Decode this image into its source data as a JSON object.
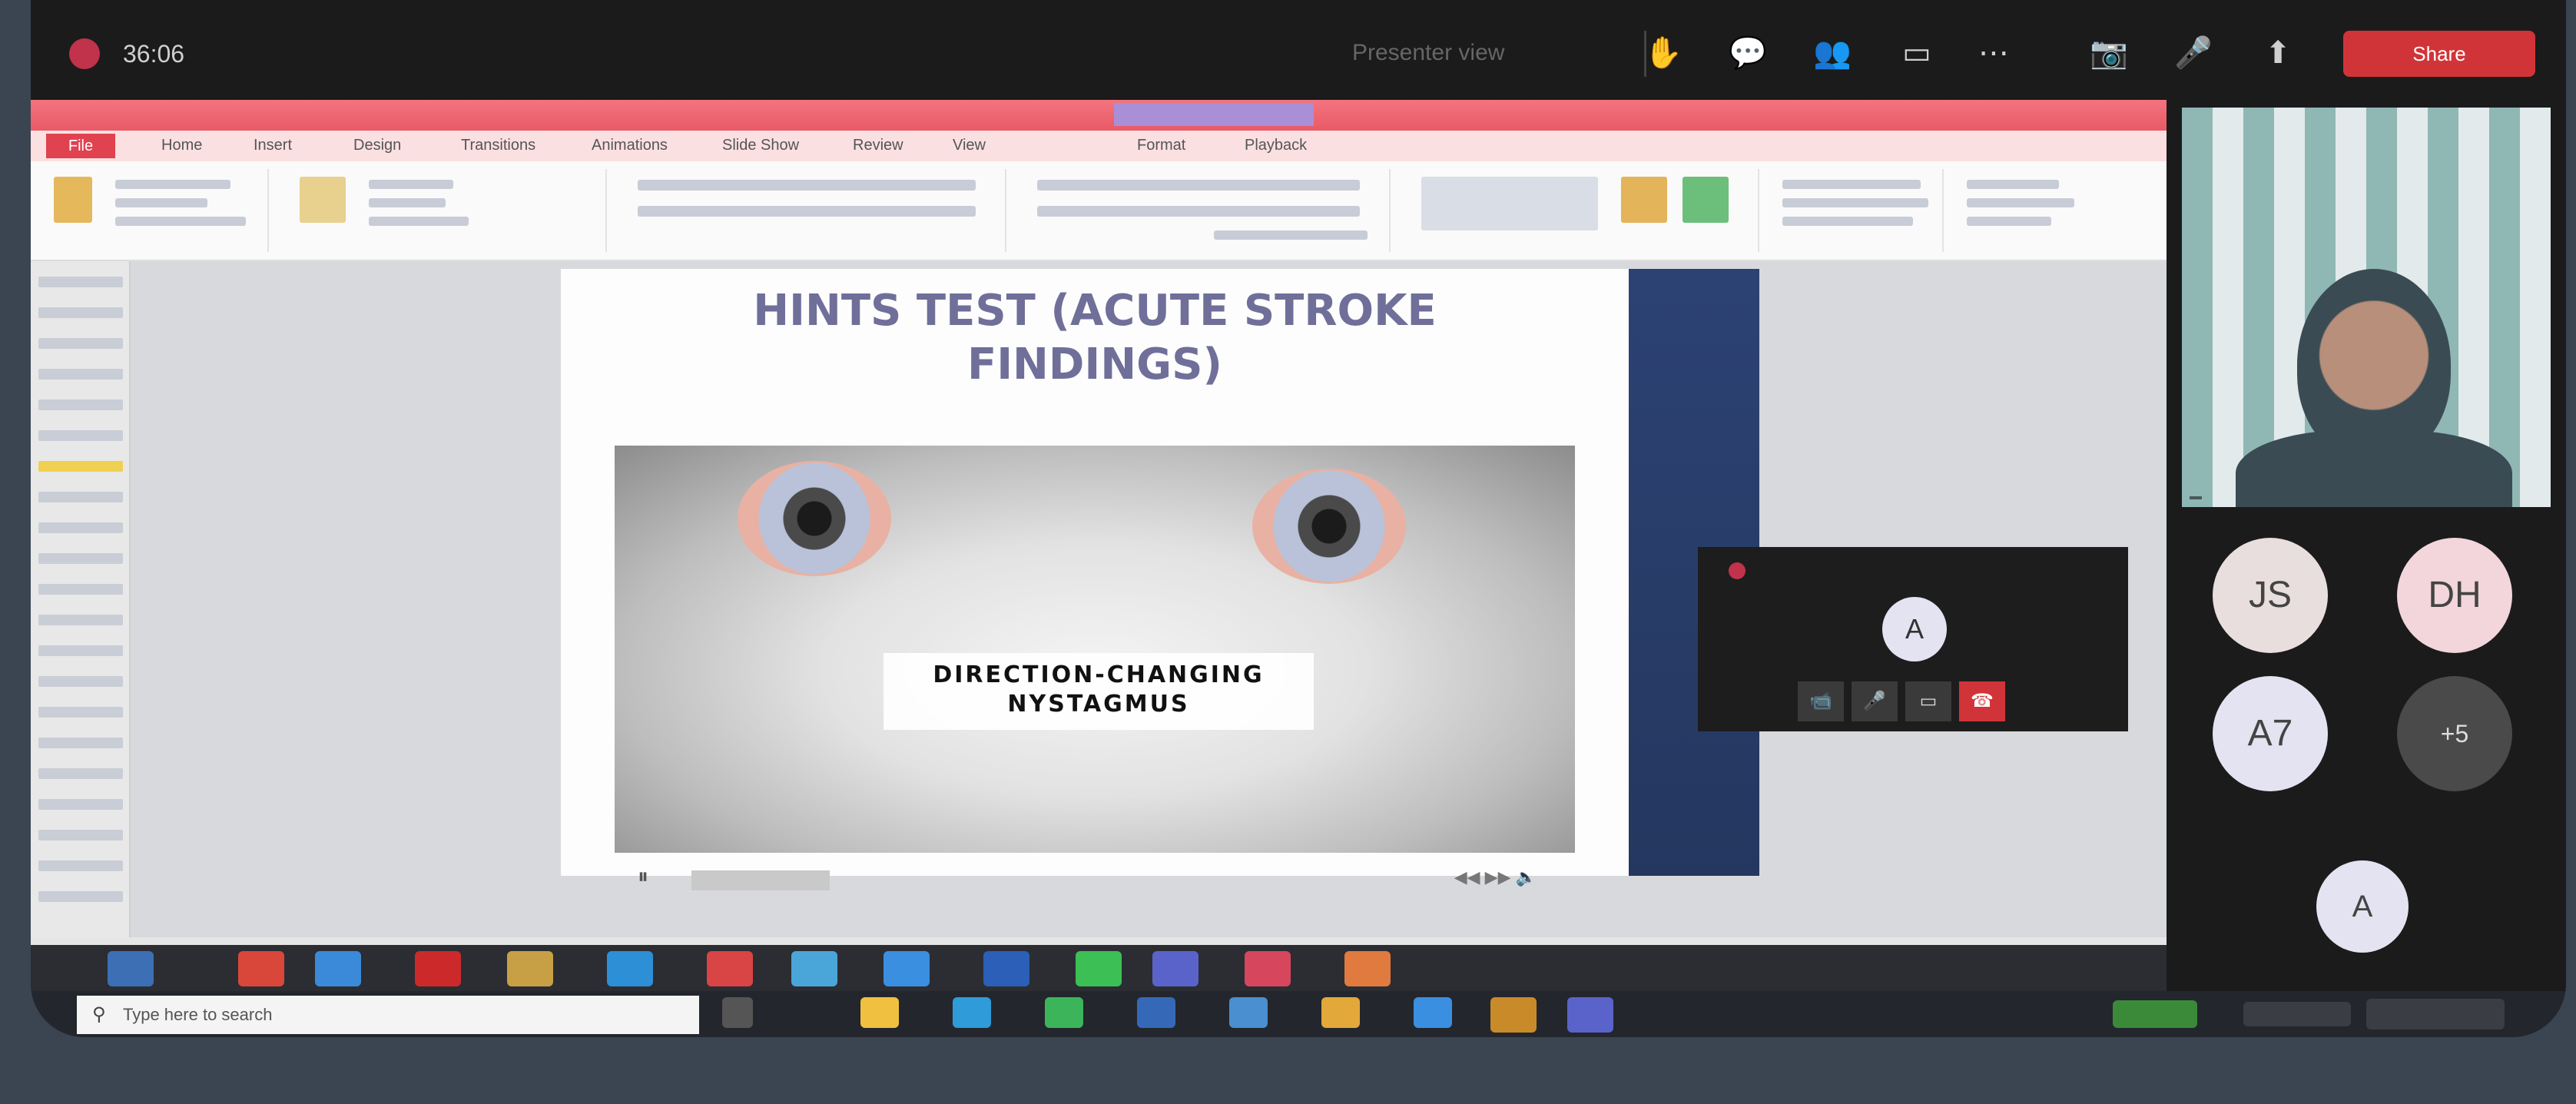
{
  "meeting": {
    "timer": "36:06",
    "presenter_note": "Presenter view",
    "share_label": "Share"
  },
  "ppt": {
    "file_tab": "File",
    "tabs": [
      "Home",
      "Insert",
      "Design",
      "Transitions",
      "Animations",
      "Slide Show",
      "Review",
      "View",
      "Format",
      "Playback"
    ]
  },
  "slide": {
    "title_line1": "HINTS TEST (ACUTE STROKE",
    "title_line2": "FINDINGS)",
    "video_caption_line1": "DIRECTION-CHANGING",
    "video_caption_line2": "NYSTAGMUS"
  },
  "mini_call": {
    "avatar_initial": "A"
  },
  "participants": [
    {
      "initials": "JS",
      "color": "#e9dede"
    },
    {
      "initials": "DH",
      "color": "#f3d5dc"
    },
    {
      "initials": "A7",
      "color": "#e4e3f1"
    },
    {
      "initials": "+5",
      "color": "#4a4a4a"
    },
    {
      "initials": "A",
      "color": "#e4e3f1"
    }
  ],
  "taskbar": {
    "search_placeholder": "Type here to search"
  },
  "colors": {
    "accent_red": "#d13438",
    "ppt_ribbon": "#e85a66",
    "slide_band": "#2c4273"
  }
}
